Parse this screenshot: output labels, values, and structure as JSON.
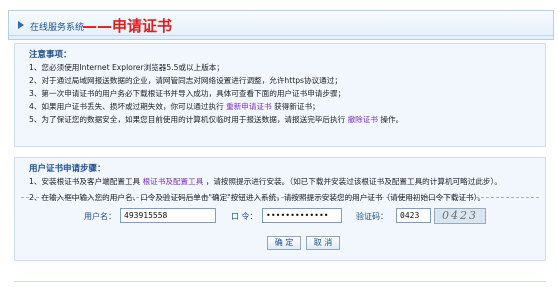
{
  "header": {
    "system_label": "在线服务系统",
    "page_title": "——申请证书"
  },
  "notices": {
    "title": "注意事项：",
    "items": [
      "1、您必须使用Internet Explorer浏览器5.5或以上版本；",
      "2、对于通过局域网报送数据的企业，请网管同志对网络设置进行调整，允许https协议通过；",
      "3、第一次申请证书的用户务必下载根证书并导入成功，具体可查看下面的用户证书申请步骤；"
    ],
    "item4": {
      "prefix": "4、如果用户证书丢失、损坏或过期失效，你可以通过执行",
      "link": "重新申请证书",
      "suffix": "获得新证书；"
    },
    "item5": {
      "prefix": "5、为了保证您的数据安全，如果您目前使用的计算机仅临时用于报送数据，请报送完毕后执行",
      "link": "撤除证书",
      "suffix": "操作。"
    }
  },
  "steps": {
    "title": "用户证书申请步骤：",
    "step1": {
      "prefix": "1、安装根证书及客户端配置工具",
      "link": "根证书及配置工具",
      "suffix": "，请按照提示进行安装。（如已下载并安装过该根证书及配置工具的计算机可略过此步）。"
    },
    "step2": "2、在输入框中输入您的用户名、口令及验证码后单击\"确定\"按钮进入系统，请按照提示安装您的用户证书（请使用初始口令下载证书）。"
  },
  "form": {
    "username_label": "用户名：",
    "username_value": "493915558",
    "password_label": "口  令：",
    "password_value": "•••••••••••••",
    "captcha_label": "验证码：",
    "captcha_value": "0423",
    "captcha_image_text": "0423",
    "ok_button": "确  定",
    "cancel_button": "取  消"
  }
}
